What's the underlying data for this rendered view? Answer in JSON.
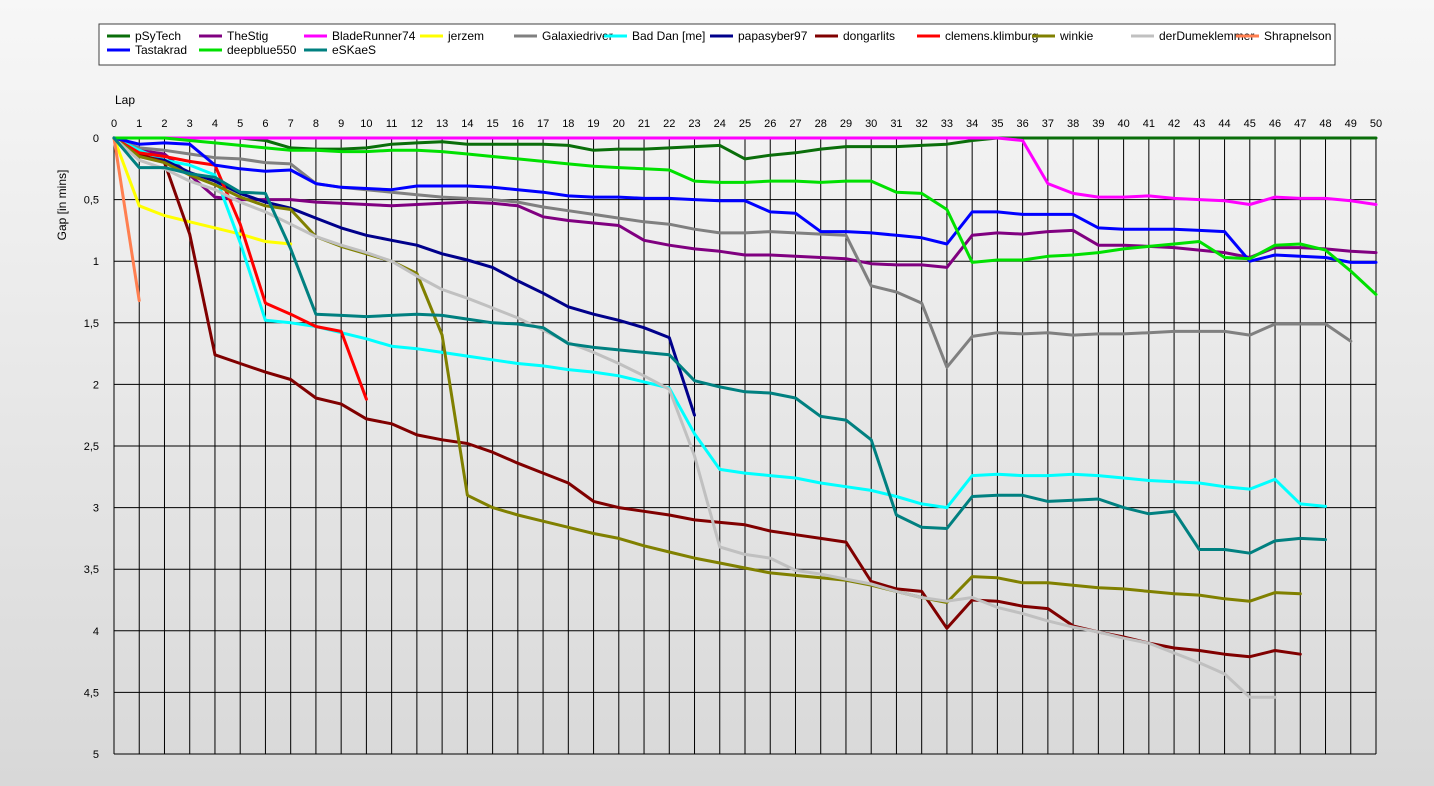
{
  "chart_data": {
    "type": "line",
    "xlabel": "Lap",
    "ylabel": "Gap [in mins]",
    "xlim": [
      0,
      50
    ],
    "ylim": [
      0,
      5
    ],
    "y_inverted": true,
    "grid": true,
    "legend_position": "top",
    "x_ticks": [
      "0",
      "1",
      "2",
      "3",
      "4",
      "5",
      "6",
      "7",
      "8",
      "9",
      "10",
      "11",
      "12",
      "13",
      "14",
      "15",
      "16",
      "17",
      "18",
      "19",
      "20",
      "21",
      "22",
      "23",
      "24",
      "25",
      "26",
      "27",
      "28",
      "29",
      "30",
      "31",
      "32",
      "33",
      "34",
      "35",
      "36",
      "37",
      "38",
      "39",
      "40",
      "41",
      "42",
      "43",
      "44",
      "45",
      "46",
      "47",
      "48",
      "49",
      "50"
    ],
    "y_ticks": [
      {
        "value": 0,
        "label": "0"
      },
      {
        "value": 0.5,
        "label": "0,5"
      },
      {
        "value": 1,
        "label": "1"
      },
      {
        "value": 1.5,
        "label": "1,5"
      },
      {
        "value": 2,
        "label": "2"
      },
      {
        "value": 2.5,
        "label": "2,5"
      },
      {
        "value": 3,
        "label": "3"
      },
      {
        "value": 3.5,
        "label": "3,5"
      },
      {
        "value": 4,
        "label": "4"
      },
      {
        "value": 4.5,
        "label": "4,5"
      },
      {
        "value": 5,
        "label": "5"
      }
    ],
    "series": [
      {
        "name": "pSyTech",
        "color": "#0a6e0a",
        "x0": 0,
        "values": [
          0,
          0,
          0,
          0,
          0,
          0,
          0.02,
          0.08,
          0.09,
          0.09,
          0.08,
          0.05,
          0.04,
          0.03,
          0.05,
          0.05,
          0.05,
          0.05,
          0.06,
          0.1,
          0.09,
          0.09,
          0.08,
          0.07,
          0.06,
          0.17,
          0.14,
          0.12,
          0.09,
          0.07,
          0.07,
          0.07,
          0.06,
          0.05,
          0.02,
          0,
          0,
          0,
          0,
          0,
          0,
          0,
          0,
          0,
          0,
          0,
          0,
          0,
          0,
          0,
          0
        ]
      },
      {
        "name": "TheStig",
        "color": "#800080",
        "x0": 0,
        "values": [
          0,
          0.1,
          0.13,
          0.3,
          0.48,
          0.5,
          0.5,
          0.5,
          0.52,
          0.53,
          0.54,
          0.55,
          0.54,
          0.53,
          0.52,
          0.53,
          0.55,
          0.64,
          0.67,
          0.69,
          0.71,
          0.83,
          0.87,
          0.9,
          0.92,
          0.95,
          0.95,
          0.96,
          0.97,
          0.98,
          1.02,
          1.03,
          1.03,
          1.05,
          0.79,
          0.77,
          0.78,
          0.76,
          0.75,
          0.87,
          0.87,
          0.88,
          0.89,
          0.91,
          0.93,
          0.97,
          0.89,
          0.89,
          0.9,
          0.92,
          0.93
        ]
      },
      {
        "name": "BladeRunner74",
        "color": "#ff00ff",
        "x0": 0,
        "values": [
          0,
          0,
          0,
          0,
          0,
          0,
          0,
          0,
          0,
          0,
          0,
          0,
          0,
          0,
          0,
          0,
          0,
          0,
          0,
          0,
          0,
          0,
          0,
          0,
          0,
          0,
          0,
          0,
          0,
          0,
          0,
          0,
          0,
          0,
          0,
          0,
          0.02,
          0.37,
          0.45,
          0.48,
          0.48,
          0.47,
          0.49,
          0.5,
          0.51,
          0.54,
          0.48,
          0.49,
          0.49,
          0.51,
          0.54
        ]
      },
      {
        "name": "jerzem",
        "color": "#ffff00",
        "x0": 0,
        "values": [
          0,
          0.55,
          0.63,
          0.68,
          0.73,
          0.78,
          0.84,
          0.86
        ]
      },
      {
        "name": "Galaxiedriver",
        "color": "#808080",
        "x0": 0,
        "values": [
          0,
          0.08,
          0.1,
          0.13,
          0.16,
          0.17,
          0.2,
          0.21,
          0.37,
          0.4,
          0.42,
          0.44,
          0.46,
          0.48,
          0.49,
          0.5,
          0.52,
          0.56,
          0.59,
          0.62,
          0.65,
          0.68,
          0.7,
          0.74,
          0.77,
          0.77,
          0.76,
          0.77,
          0.78,
          0.79,
          1.2,
          1.25,
          1.34,
          1.86,
          1.61,
          1.58,
          1.59,
          1.58,
          1.6,
          1.59,
          1.59,
          1.58,
          1.57,
          1.57,
          1.57,
          1.6,
          1.51,
          1.51,
          1.51,
          1.65
        ]
      },
      {
        "name": "Bad Dan [me]",
        "color": "#00ffff",
        "x0": 0,
        "values": [
          0,
          0.1,
          0.18,
          0.22,
          0.3,
          0.85,
          1.48,
          1.5,
          1.53,
          1.58,
          1.63,
          1.69,
          1.71,
          1.74,
          1.77,
          1.8,
          1.83,
          1.85,
          1.88,
          1.9,
          1.93,
          1.98,
          2.03,
          2.4,
          2.69,
          2.72,
          2.74,
          2.76,
          2.8,
          2.83,
          2.86,
          2.91,
          2.97,
          3.0,
          2.74,
          2.73,
          2.74,
          2.74,
          2.73,
          2.74,
          2.76,
          2.78,
          2.79,
          2.8,
          2.83,
          2.85,
          2.77,
          2.97,
          2.99
        ]
      },
      {
        "name": "papasyber97",
        "color": "#00008b",
        "x0": 0,
        "values": [
          0,
          0.15,
          0.18,
          0.28,
          0.35,
          0.45,
          0.52,
          0.57,
          0.65,
          0.73,
          0.79,
          0.83,
          0.87,
          0.94,
          0.99,
          1.05,
          1.16,
          1.26,
          1.37,
          1.43,
          1.48,
          1.54,
          1.62,
          2.25
        ]
      },
      {
        "name": "dongarlits",
        "color": "#800000",
        "x0": 0,
        "values": [
          0,
          0.13,
          0.2,
          0.78,
          1.76,
          1.83,
          1.9,
          1.96,
          2.11,
          2.16,
          2.28,
          2.32,
          2.41,
          2.45,
          2.48,
          2.55,
          2.64,
          2.72,
          2.8,
          2.95,
          3.0,
          3.03,
          3.06,
          3.1,
          3.12,
          3.14,
          3.19,
          3.22,
          3.25,
          3.28,
          3.6,
          3.66,
          3.68,
          3.98,
          3.75,
          3.76,
          3.8,
          3.82,
          3.96,
          4.01,
          4.05,
          4.1,
          4.14,
          4.16,
          4.19,
          4.21,
          4.16,
          4.19
        ]
      },
      {
        "name": "clemens.klimburg",
        "color": "#ff0000",
        "x0": 0,
        "values": [
          0,
          0.12,
          0.15,
          0.19,
          0.22,
          0.7,
          1.34,
          1.43,
          1.53,
          1.57,
          2.12
        ]
      },
      {
        "name": "winkie",
        "color": "#808000",
        "x0": 0,
        "values": [
          0,
          0.15,
          0.2,
          0.3,
          0.38,
          0.48,
          0.55,
          0.58,
          0.8,
          0.88,
          0.94,
          1.0,
          1.1,
          1.6,
          2.9,
          3.0,
          3.06,
          3.11,
          3.16,
          3.21,
          3.25,
          3.31,
          3.36,
          3.41,
          3.45,
          3.49,
          3.53,
          3.55,
          3.57,
          3.59,
          3.63,
          3.68,
          3.73,
          3.77,
          3.56,
          3.57,
          3.61,
          3.61,
          3.63,
          3.65,
          3.66,
          3.68,
          3.7,
          3.71,
          3.74,
          3.76,
          3.69,
          3.7
        ]
      },
      {
        "name": "derDumeklemmer",
        "color": "#c0c0c0",
        "x0": 0,
        "values": [
          0,
          0.18,
          0.25,
          0.35,
          0.42,
          0.52,
          0.6,
          0.7,
          0.8,
          0.87,
          0.93,
          1.0,
          1.12,
          1.23,
          1.3,
          1.38,
          1.46,
          1.56,
          1.66,
          1.74,
          1.83,
          1.93,
          2.04,
          2.58,
          3.32,
          3.38,
          3.41,
          3.51,
          3.54,
          3.58,
          3.62,
          3.68,
          3.73,
          3.76,
          3.73,
          3.81,
          3.86,
          3.92,
          3.97,
          4.01,
          4.06,
          4.1,
          4.18,
          4.26,
          4.35,
          4.54,
          4.54
        ]
      },
      {
        "name": "Shrapnelson",
        "color": "#ff7f50",
        "x0": 0,
        "values": [
          0,
          1.32
        ]
      },
      {
        "name": "Tastakrad",
        "color": "#0000ff",
        "x0": 0,
        "values": [
          0,
          0.05,
          0.04,
          0.05,
          0.22,
          0.25,
          0.27,
          0.26,
          0.37,
          0.4,
          0.41,
          0.42,
          0.39,
          0.39,
          0.39,
          0.4,
          0.42,
          0.44,
          0.47,
          0.48,
          0.48,
          0.49,
          0.49,
          0.5,
          0.51,
          0.51,
          0.6,
          0.61,
          0.76,
          0.76,
          0.77,
          0.79,
          0.81,
          0.86,
          0.6,
          0.6,
          0.62,
          0.62,
          0.62,
          0.73,
          0.74,
          0.74,
          0.74,
          0.75,
          0.76,
          1.0,
          0.95,
          0.96,
          0.97,
          1.01,
          1.01
        ]
      },
      {
        "name": "deepblue550",
        "color": "#00e000",
        "x0": 0,
        "values": [
          0,
          0,
          0,
          0.02,
          0.04,
          0.06,
          0.08,
          0.1,
          0.1,
          0.11,
          0.11,
          0.1,
          0.1,
          0.11,
          0.13,
          0.15,
          0.17,
          0.19,
          0.21,
          0.23,
          0.24,
          0.25,
          0.26,
          0.35,
          0.36,
          0.36,
          0.35,
          0.35,
          0.36,
          0.35,
          0.35,
          0.44,
          0.45,
          0.58,
          1.01,
          0.99,
          0.99,
          0.96,
          0.95,
          0.93,
          0.9,
          0.88,
          0.86,
          0.84,
          0.97,
          0.98,
          0.87,
          0.86,
          0.91,
          1.08,
          1.27
        ]
      },
      {
        "name": "eSKaeS",
        "color": "#008080",
        "x0": 0,
        "values": [
          0,
          0.24,
          0.24,
          0.29,
          0.32,
          0.44,
          0.45,
          0.9,
          1.43,
          1.44,
          1.45,
          1.44,
          1.43,
          1.44,
          1.47,
          1.5,
          1.51,
          1.54,
          1.67,
          1.7,
          1.72,
          1.74,
          1.76,
          1.97,
          2.02,
          2.06,
          2.07,
          2.11,
          2.26,
          2.29,
          2.45,
          3.06,
          3.16,
          3.17,
          2.91,
          2.9,
          2.9,
          2.95,
          2.94,
          2.93,
          3.0,
          3.05,
          3.03,
          3.34,
          3.34,
          3.37,
          3.27,
          3.25,
          3.26
        ]
      }
    ]
  }
}
